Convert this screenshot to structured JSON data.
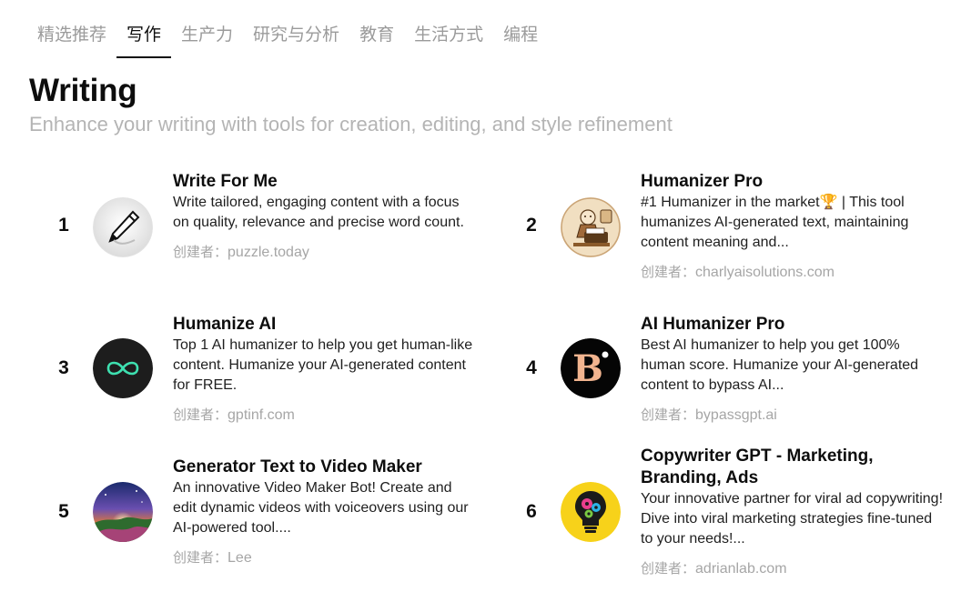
{
  "tabs": [
    "精选推荐",
    "写作",
    "生产力",
    "研究与分析",
    "教育",
    "生活方式",
    "编程"
  ],
  "active_tab_index": 1,
  "section": {
    "title": "Writing",
    "subtitle": "Enhance your writing with tools for creation, editing, and style refinement"
  },
  "author_prefix": "创建者：",
  "items": [
    {
      "rank": "1",
      "title": "Write For Me",
      "description": "Write tailored, engaging content with a focus on quality, relevance and precise word count.",
      "author": "puzzle.today",
      "icon": "pen-icon"
    },
    {
      "rank": "2",
      "title": "Humanizer Pro",
      "description": "#1 Humanizer in the market🏆 | This tool humanizes AI-generated text, maintaining content meaning and...",
      "author": "charlyaisolutions.com",
      "icon": "writer-at-typewriter-icon"
    },
    {
      "rank": "3",
      "title": "Humanize AI",
      "description": "Top 1 AI humanizer to help you get human-like content. Humanize your AI-generated content for FREE.",
      "author": "gptinf.com",
      "icon": "infinity-icon"
    },
    {
      "rank": "4",
      "title": "AI Humanizer Pro",
      "description": "Best AI humanizer to help you get 100% human score. Humanize your AI-generated content to bypass AI...",
      "author": "bypassgpt.ai",
      "icon": "letter-b-icon"
    },
    {
      "rank": "5",
      "title": "Generator Text to Video Maker",
      "description": "An innovative Video Maker Bot! Create and edit dynamic videos with voiceovers using our AI-powered tool....",
      "author": "Lee",
      "icon": "fantasy-landscape-icon"
    },
    {
      "rank": "6",
      "title": "Copywriter GPT - Marketing, Branding, Ads",
      "description": "Your innovative partner for viral ad copywriting! Dive into viral marketing strategies fine-tuned to your needs!...",
      "author": "adrianlab.com",
      "icon": "lightbulb-gears-icon"
    }
  ]
}
